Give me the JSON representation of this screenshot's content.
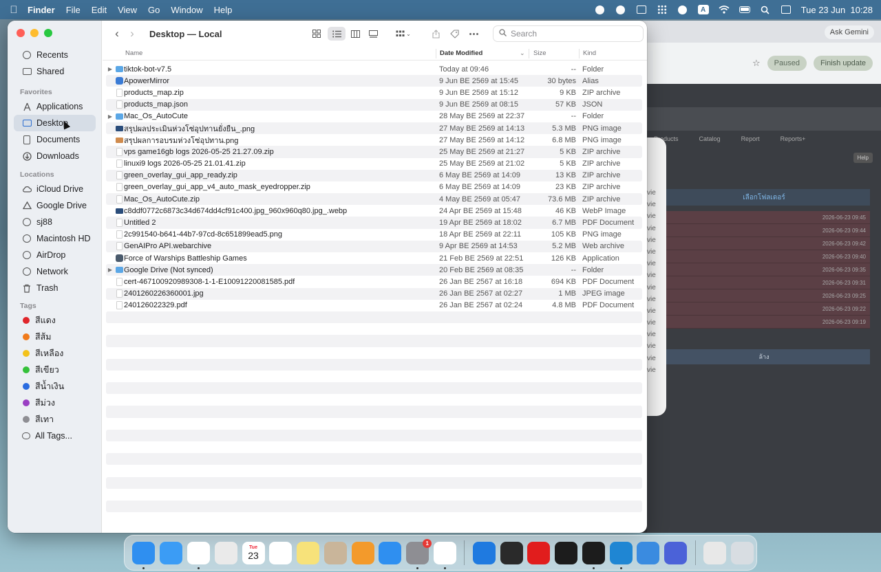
{
  "menubar": {
    "app_name": "Finder",
    "menus": [
      "File",
      "Edit",
      "View",
      "Go",
      "Window",
      "Help"
    ],
    "clock": "Tue 23 Jun  10:28"
  },
  "browser": {
    "ask_gemini": "Ask Gemini",
    "paused": "Paused",
    "finish_update": "Finish update",
    "tabs": [
      "Products",
      "Catalog",
      "Report",
      "Reports+"
    ],
    "help": "Help",
    "folder_button": "เลือกโฟลเดอร์",
    "clear_button": "ล้าง",
    "row_dates": [
      "2026-06-23 09:45",
      "2026-06-23 09:44",
      "2026-06-23 09:42",
      "2026-06-23 09:40",
      "2026-06-23 09:35",
      "2026-06-23 09:31",
      "2026-06-23 09:25",
      "2026-06-23 09:22",
      "2026-06-23 09:19"
    ]
  },
  "dialog": {
    "items": [
      "vie",
      "vie",
      "vie",
      "vie",
      "vie",
      "vie",
      "vie",
      "vie",
      "vie",
      "vie",
      "vie",
      "vie",
      "vie",
      "vie",
      "vie",
      "vie"
    ]
  },
  "finder": {
    "title": "Desktop — Local",
    "search_placeholder": "Search",
    "columns": {
      "name": "Name",
      "date": "Date Modified",
      "size": "Size",
      "kind": "Kind"
    },
    "sidebar": {
      "top": [
        {
          "label": "Recents",
          "icon": "clock-icon"
        },
        {
          "label": "Shared",
          "icon": "shared-folder-icon"
        }
      ],
      "favorites_heading": "Favorites",
      "favorites": [
        {
          "label": "Applications",
          "icon": "applications-icon"
        },
        {
          "label": "Desktop",
          "icon": "desktop-icon",
          "selected": true
        },
        {
          "label": "Documents",
          "icon": "document-icon"
        },
        {
          "label": "Downloads",
          "icon": "download-icon"
        }
      ],
      "locations_heading": "Locations",
      "locations": [
        {
          "label": "iCloud Drive",
          "icon": "cloud-icon"
        },
        {
          "label": "Google Drive",
          "icon": "drive-icon"
        },
        {
          "label": "sj88",
          "icon": "globe-icon"
        },
        {
          "label": "Macintosh HD",
          "icon": "disk-icon"
        },
        {
          "label": "AirDrop",
          "icon": "airdrop-icon"
        },
        {
          "label": "Network",
          "icon": "network-icon"
        },
        {
          "label": "Trash",
          "icon": "trash-icon"
        }
      ],
      "tags_heading": "Tags",
      "tags": [
        {
          "label": "สีแดง",
          "color": "#e0262b"
        },
        {
          "label": "สีส้ม",
          "color": "#f07a1a"
        },
        {
          "label": "สีเหลือง",
          "color": "#f3c21b"
        },
        {
          "label": "สีเขียว",
          "color": "#35c13a"
        },
        {
          "label": "สีน้ำเงิน",
          "color": "#2a6ce0"
        },
        {
          "label": "สีม่วง",
          "color": "#9a3fc3"
        },
        {
          "label": "สีเทา",
          "color": "#8e8e93"
        }
      ],
      "all_tags": "All Tags..."
    },
    "files": [
      {
        "name": "tiktok-bot-v7.5",
        "date": "Today at 09:46",
        "size": "--",
        "kind": "Folder",
        "icon": "folder",
        "expandable": true
      },
      {
        "name": "ApowerMirror",
        "date": "9 Jun BE 2569 at 15:45",
        "size": "30 bytes",
        "kind": "Alias",
        "icon": "alias"
      },
      {
        "name": "products_map.zip",
        "date": "9 Jun BE 2569 at 15:12",
        "size": "9 KB",
        "kind": "ZIP archive",
        "icon": "zip"
      },
      {
        "name": "products_map.json",
        "date": "9 Jun BE 2569 at 08:15",
        "size": "57 KB",
        "kind": "JSON",
        "icon": "json"
      },
      {
        "name": "Mac_Os_AutoCute",
        "date": "28 May BE 2569 at 22:37",
        "size": "--",
        "kind": "Folder",
        "icon": "folder",
        "expandable": true
      },
      {
        "name": "สรุปผลประเมินห่วงโซ่อุปทานยั่งยืน_.png",
        "date": "27 May BE 2569 at 14:13",
        "size": "5.3 MB",
        "kind": "PNG image",
        "icon": "png"
      },
      {
        "name": "สรุปผลการอบรมห่วงโซ่อุปทาน.png",
        "date": "27 May BE 2569 at 14:12",
        "size": "6.8 MB",
        "kind": "PNG image",
        "icon": "png2"
      },
      {
        "name": "vps game16gb logs 2026-05-25 21.27.09.zip",
        "date": "25 May BE 2569 at 21:27",
        "size": "5 KB",
        "kind": "ZIP archive",
        "icon": "zip"
      },
      {
        "name": "linuxi9 logs 2026-05-25 21.01.41.zip",
        "date": "25 May BE 2569 at 21:02",
        "size": "5 KB",
        "kind": "ZIP archive",
        "icon": "zip"
      },
      {
        "name": "green_overlay_gui_app_ready.zip",
        "date": "6 May BE 2569 at 14:09",
        "size": "13 KB",
        "kind": "ZIP archive",
        "icon": "zip"
      },
      {
        "name": "green_overlay_gui_app_v4_auto_mask_eyedropper.zip",
        "date": "6 May BE 2569 at 14:09",
        "size": "23 KB",
        "kind": "ZIP archive",
        "icon": "zip"
      },
      {
        "name": "Mac_Os_AutoCute.zip",
        "date": "4 May BE 2569 at 05:47",
        "size": "73.6 MB",
        "kind": "ZIP archive",
        "icon": "zip"
      },
      {
        "name": "c8ddf0772c6873c34d674dd4cf91c400.jpg_960x960q80.jpg_.webp",
        "date": "24 Apr BE 2569 at 15:48",
        "size": "46 KB",
        "kind": "WebP Image",
        "icon": "png"
      },
      {
        "name": "Untitled 2",
        "date": "19 Apr BE 2569 at 18:02",
        "size": "6.7 MB",
        "kind": "PDF Document",
        "icon": "doc"
      },
      {
        "name": "2c991540-b641-44b7-97cd-8c651899ead5.png",
        "date": "18 Apr BE 2569 at 22:11",
        "size": "105 KB",
        "kind": "PNG image",
        "icon": "doc"
      },
      {
        "name": "GenAIPro API.webarchive",
        "date": "9 Apr BE 2569 at 14:53",
        "size": "5.2 MB",
        "kind": "Web archive",
        "icon": "doc"
      },
      {
        "name": "Force of Warships Battleship Games",
        "date": "21 Feb BE 2569 at 22:51",
        "size": "126 KB",
        "kind": "Application",
        "icon": "app"
      },
      {
        "name": "Google Drive (Not synced)",
        "date": "20 Feb BE 2569 at 08:35",
        "size": "--",
        "kind": "Folder",
        "icon": "folder",
        "expandable": true
      },
      {
        "name": "cert-467100920989308-1-1-E10091220081585.pdf",
        "date": "26 Jan BE 2567 at 16:18",
        "size": "694 KB",
        "kind": "PDF Document",
        "icon": "doc"
      },
      {
        "name": "2401260226360001.jpg",
        "date": "26 Jan BE 2567 at 02:27",
        "size": "1 MB",
        "kind": "JPEG image",
        "icon": "doc"
      },
      {
        "name": "240126022329.pdf",
        "date": "26 Jan BE 2567 at 02:24",
        "size": "4.8 MB",
        "kind": "PDF Document",
        "icon": "doc"
      }
    ]
  },
  "dock": {
    "apps": [
      {
        "name": "finder-app",
        "color": "#2f8ff0",
        "running": true
      },
      {
        "name": "safari-app",
        "color": "#3b9cf5",
        "running": false
      },
      {
        "name": "chrome-app",
        "color": "#ffffff",
        "running": true
      },
      {
        "name": "launchpad-app",
        "color": "#eaeaea",
        "running": false
      },
      {
        "name": "calendar-app",
        "color": "#ffffff",
        "running": false,
        "label_top": "Tue",
        "label": "23"
      },
      {
        "name": "reminders-app",
        "color": "#ffffff",
        "running": false
      },
      {
        "name": "notes-app",
        "color": "#f7e27a",
        "running": false
      },
      {
        "name": "contacts-app",
        "color": "#c9b59a",
        "running": false
      },
      {
        "name": "pages-app",
        "color": "#f39a2b",
        "running": false
      },
      {
        "name": "app-store-app",
        "color": "#2f8ff0",
        "running": false
      },
      {
        "name": "system-settings-app",
        "color": "#8e8e93",
        "running": true,
        "badge": "1"
      },
      {
        "name": "ghost-app",
        "color": "#ffffff",
        "running": true
      },
      {
        "name": "windows-app",
        "color": "#1f7ae0",
        "running": false
      },
      {
        "name": "grid-app",
        "color": "#2a2a2a",
        "running": false
      },
      {
        "name": "mi-app",
        "color": "#e11d1d",
        "running": false
      },
      {
        "name": "activity-monitor-app",
        "color": "#1c1c1c",
        "running": false
      },
      {
        "name": "terminal-app",
        "color": "#1c1c1c",
        "running": true
      },
      {
        "name": "vscode-app",
        "color": "#1f86d3",
        "running": true
      },
      {
        "name": "qbit-app",
        "color": "#3a8be0",
        "running": false
      },
      {
        "name": "mirror-app",
        "color": "#4b62d8",
        "running": false
      },
      {
        "name": "files-stack",
        "color": "#e8e8e8",
        "running": false
      },
      {
        "name": "trash-app",
        "color": "#d8dde2",
        "running": false
      }
    ]
  }
}
